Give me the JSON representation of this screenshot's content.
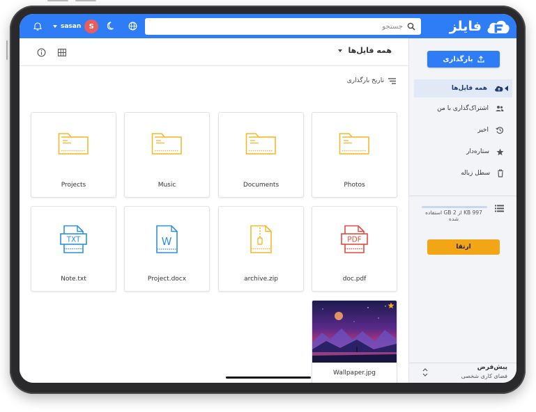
{
  "app": {
    "logo_text": "فایلز",
    "brand_color": "#2f7df6",
    "accent_color": "#f2a615"
  },
  "topbar": {
    "search_placeholder": "جستجو",
    "user_name": "sasan",
    "avatar_letter": "S",
    "icons": [
      "globe-icon",
      "moon-icon",
      "bell-icon",
      "search-icon"
    ]
  },
  "main": {
    "folder_title": "همه فایل‌ها",
    "sort_label": "تاریخ بارگذاری",
    "items": [
      {
        "name": "Photos",
        "type": "folder"
      },
      {
        "name": "Documents",
        "type": "folder"
      },
      {
        "name": "Music",
        "type": "folder"
      },
      {
        "name": "Projects",
        "type": "folder"
      },
      {
        "name": "doc.pdf",
        "type": "pdf",
        "badge": "PDF"
      },
      {
        "name": "archive.zip",
        "type": "zip"
      },
      {
        "name": "Project.docx",
        "type": "docx",
        "badge": "W"
      },
      {
        "name": "Note.txt",
        "type": "txt",
        "badge": "TXT"
      },
      {
        "name": "Wallpaper.jpg",
        "type": "image",
        "starred": true
      }
    ]
  },
  "sidebar": {
    "upload_label": "بارگذاری",
    "nav": [
      {
        "label": "همه فایل‌ها",
        "icon": "cloud-icon",
        "active": true
      },
      {
        "label": "اشتراک‌گذاری با من",
        "icon": "people-icon",
        "active": false
      },
      {
        "label": "اخیر",
        "icon": "history-icon",
        "active": false
      },
      {
        "label": "ستاره‌دار",
        "icon": "star-icon",
        "active": false
      },
      {
        "label": "سطل زباله",
        "icon": "trash-icon",
        "active": false
      }
    ],
    "storage_text": "997 KB از 2 GB استفاده شده",
    "storage_fraction": 0.0005,
    "upgrade_label": "ارتقا",
    "workspace_title": "پیش‌فرض",
    "workspace_subtitle": "فضای کاری شخصی"
  }
}
